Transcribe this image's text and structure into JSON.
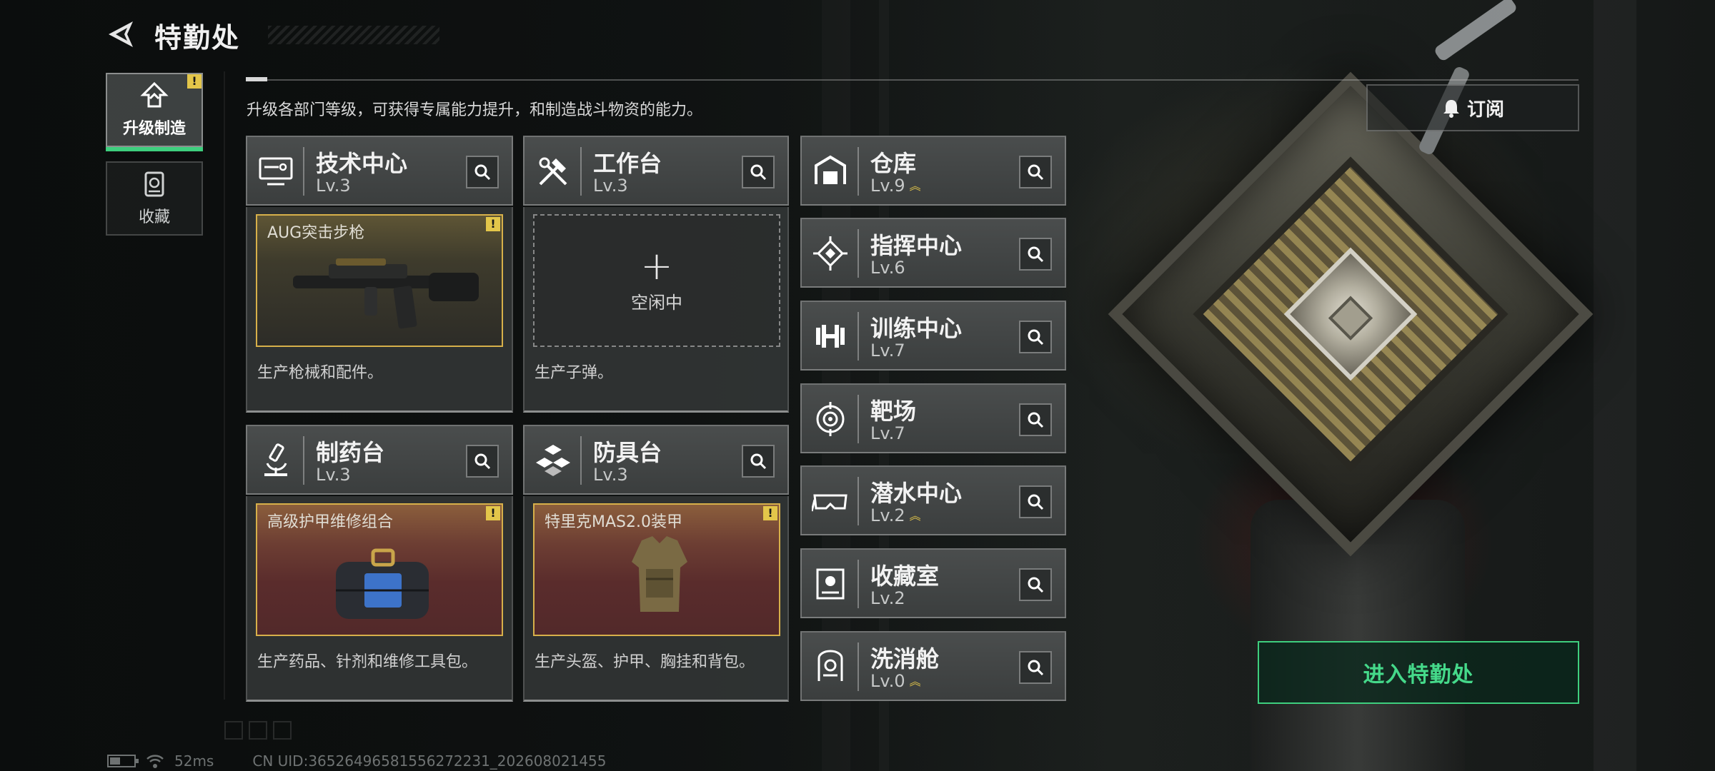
{
  "header": {
    "title": "特勤处",
    "intro": "升级各部门等级，可获得专属能力提升，和制造战斗物资的能力。"
  },
  "nav": {
    "items": [
      {
        "label": "升级制造",
        "icon": "upgrade-icon",
        "active": true,
        "alert": "!"
      },
      {
        "label": "收藏",
        "icon": "collection-icon",
        "active": false
      }
    ]
  },
  "production": [
    {
      "name": "技术中心",
      "level": "Lv.3",
      "icon": "monitor-icon",
      "slot": {
        "item": "AUG突击步枪",
        "alert": "!",
        "state": "producing"
      },
      "desc": "生产枪械和配件。"
    },
    {
      "name": "工作台",
      "level": "Lv.3",
      "icon": "tools-icon",
      "slot": {
        "state": "idle",
        "plus": "+",
        "idle_label": "空闲中"
      },
      "desc": "生产子弹。"
    },
    {
      "name": "制药台",
      "level": "Lv.3",
      "icon": "microscope-icon",
      "slot": {
        "item": "高级护甲维修组合",
        "alert": "!",
        "state": "producing"
      },
      "desc": "生产药品、针剂和维修工具包。"
    },
    {
      "name": "防具台",
      "level": "Lv.3",
      "icon": "armor-blocks-icon",
      "slot": {
        "item": "特里克MAS2.0装甲",
        "alert": "!",
        "state": "producing"
      },
      "desc": "生产头盔、护甲、胸挂和背包。"
    }
  ],
  "departments": [
    {
      "name": "仓库",
      "level": "Lv.9",
      "upgradeable": true,
      "icon": "warehouse-icon"
    },
    {
      "name": "指挥中心",
      "level": "Lv.6",
      "upgradeable": false,
      "icon": "chip-icon"
    },
    {
      "name": "训练中心",
      "level": "Lv.7",
      "upgradeable": false,
      "icon": "dumbbell-icon"
    },
    {
      "name": "靶场",
      "level": "Lv.7",
      "upgradeable": false,
      "icon": "target-icon"
    },
    {
      "name": "潜水中心",
      "level": "Lv.2",
      "upgradeable": true,
      "icon": "diving-mask-icon"
    },
    {
      "name": "收藏室",
      "level": "Lv.2",
      "upgradeable": false,
      "icon": "display-case-icon"
    },
    {
      "name": "洗消舱",
      "level": "Lv.0",
      "upgradeable": true,
      "icon": "decon-pod-icon"
    }
  ],
  "actions": {
    "subscribe": "订阅",
    "enter": "进入特勤处"
  },
  "footer": {
    "ping": "52ms",
    "uid": "CN UID:3652649658155627223​1_202608021455"
  },
  "colors": {
    "accent_green": "#3ecf7e",
    "alert_yellow": "#e3c64a",
    "slot_border": "#d7b04a"
  }
}
